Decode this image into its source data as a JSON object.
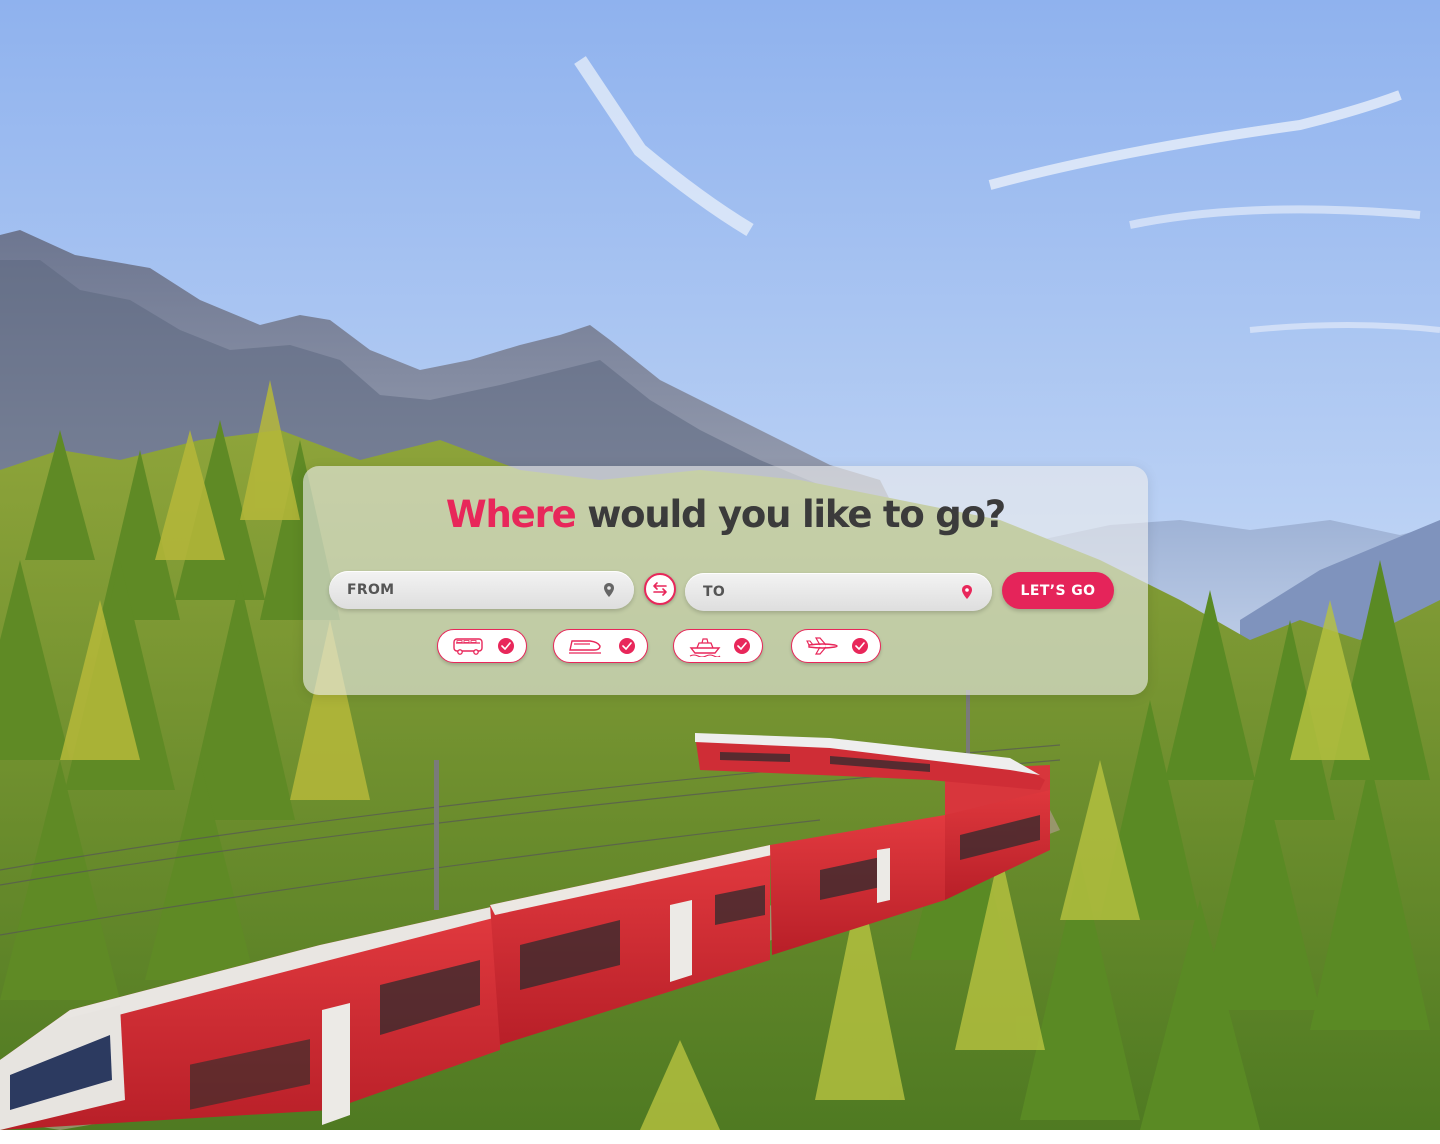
{
  "hero": {
    "headline_accent": "Where",
    "headline_rest": " would you like to go?"
  },
  "search": {
    "from_label": "FROM",
    "to_label": "TO",
    "go_label": "LET’S GO",
    "swap_icon": "swap-arrows-icon",
    "location_icon": "map-pin-icon"
  },
  "transport_modes": [
    {
      "name": "bus",
      "icon": "bus-icon",
      "selected": true
    },
    {
      "name": "train",
      "icon": "train-icon",
      "selected": true
    },
    {
      "name": "ship",
      "icon": "ship-icon",
      "selected": true
    },
    {
      "name": "plane",
      "icon": "plane-icon",
      "selected": true
    }
  ],
  "colors": {
    "accent": "#e8275a",
    "headline_dark": "#3b3b3b",
    "panel": "#ececec"
  }
}
